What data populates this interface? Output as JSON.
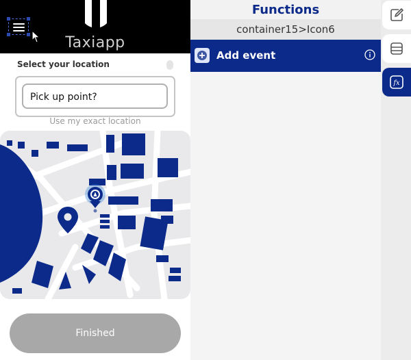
{
  "app": {
    "title": "Taxiapp",
    "select_location_label": "Select your location",
    "pickup_placeholder": "Pick up point?",
    "exact_location_link": "Use my exact location",
    "finished_button": "Finished"
  },
  "panel": {
    "title": "Functions",
    "breadcrumb": "container15>Icon6",
    "add_event_label": "Add event"
  },
  "rail": {
    "items": [
      "edit-icon",
      "database-icon",
      "fx-icon"
    ],
    "active": "fx-icon"
  },
  "colors": {
    "brand": "#0b2a8a",
    "header_bg": "#000000",
    "button_disabled": "#a8a8a8"
  }
}
